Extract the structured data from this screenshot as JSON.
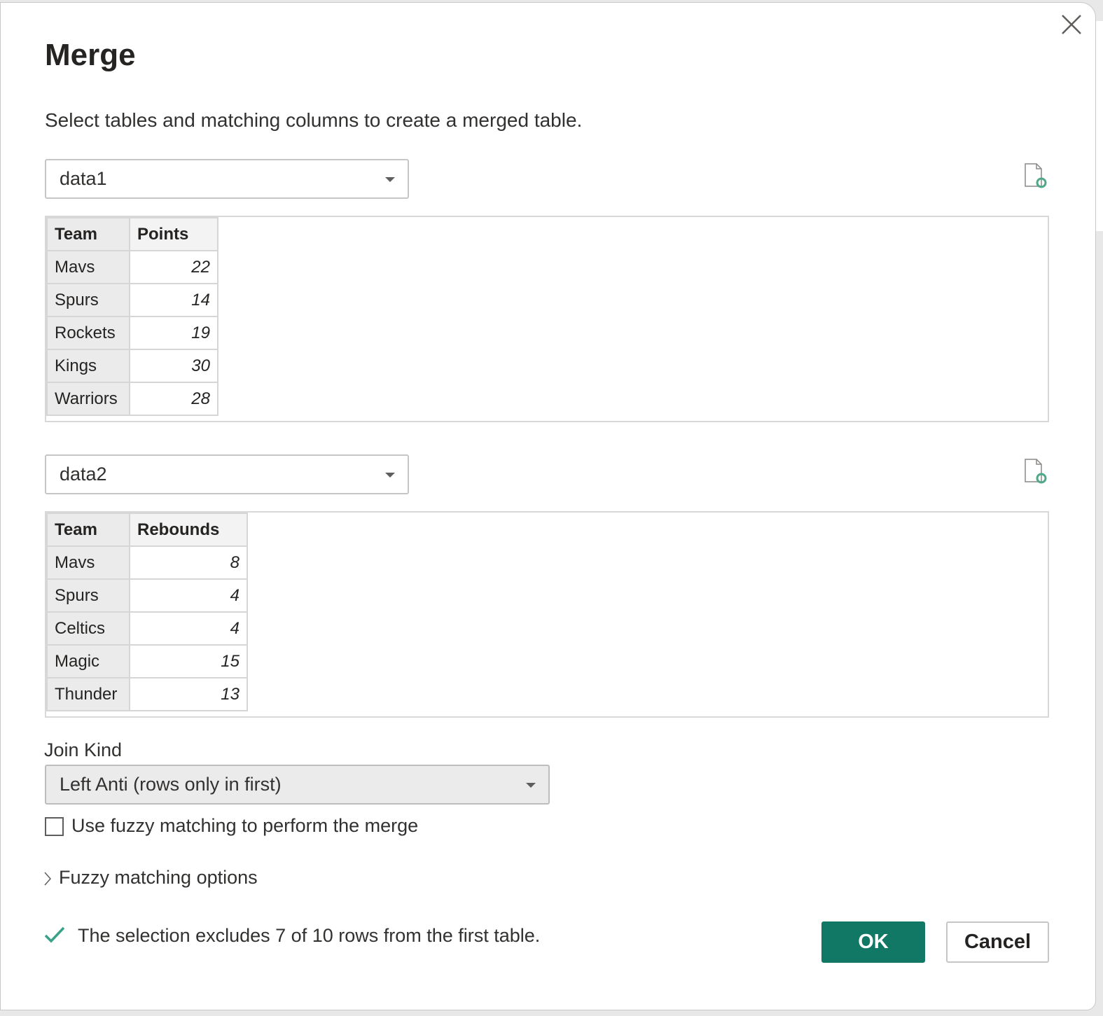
{
  "dialog": {
    "title": "Merge",
    "subtitle": "Select tables and matching columns to create a merged table."
  },
  "table1": {
    "selected": "data1",
    "columns": [
      "Team",
      "Points"
    ],
    "rows": [
      [
        "Mavs",
        "22"
      ],
      [
        "Spurs",
        "14"
      ],
      [
        "Rockets",
        "19"
      ],
      [
        "Kings",
        "30"
      ],
      [
        "Warriors",
        "28"
      ]
    ]
  },
  "table2": {
    "selected": "data2",
    "columns": [
      "Team",
      "Rebounds"
    ],
    "rows": [
      [
        "Mavs",
        "8"
      ],
      [
        "Spurs",
        "4"
      ],
      [
        "Celtics",
        "4"
      ],
      [
        "Magic",
        "15"
      ],
      [
        "Thunder",
        "13"
      ]
    ]
  },
  "join": {
    "label": "Join Kind",
    "selected": "Left Anti (rows only in first)"
  },
  "fuzzy": {
    "checkbox_label": "Use fuzzy matching to perform the merge",
    "checked": false,
    "options_label": "Fuzzy matching options"
  },
  "status": {
    "text": "The selection excludes 7 of 10 rows from the first table.",
    "color": "#117865"
  },
  "buttons": {
    "ok": "OK",
    "cancel": "Cancel"
  },
  "colors": {
    "accent": "#117865"
  }
}
